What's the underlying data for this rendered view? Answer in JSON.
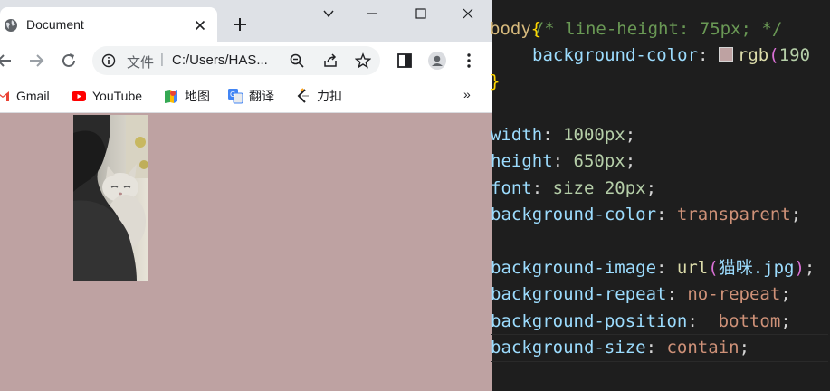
{
  "browser": {
    "tab_title": "Document",
    "address": {
      "scheme_label": "文件",
      "separator": "|",
      "url": "C:/Users/HAS..."
    },
    "bookmarks": [
      {
        "label": "Gmail",
        "icon": "gmail-icon"
      },
      {
        "label": "YouTube",
        "icon": "youtube-icon"
      },
      {
        "label": "地图",
        "icon": "maps-icon"
      },
      {
        "label": "翻译",
        "icon": "translate-icon"
      },
      {
        "label": "力扣",
        "icon": "leetcode-icon"
      }
    ],
    "bookmarks_more": "»",
    "page_background": "#bea2a2"
  },
  "editor": {
    "line1": {
      "text": "/* line-height: 75px; */"
    },
    "line2": {
      "selector": "body",
      "brace": "{"
    },
    "line3": {
      "prop": "background-color",
      "fn": "rgb",
      "args": "190",
      "swatch": "#bea2a2"
    },
    "line4": {
      "brace": "}"
    },
    "line5": {
      "prop": "width",
      "value": "1000px"
    },
    "line6": {
      "prop": "height",
      "value": "650px"
    },
    "line7": {
      "prop": "font",
      "value": "size 20px"
    },
    "line8": {
      "prop": "background-color",
      "value": "transparent"
    },
    "line9": {
      "prop": "background-image",
      "fn": "url",
      "arg": "猫咪.jpg"
    },
    "line10": {
      "prop": "background-repeat",
      "value": "no-repeat"
    },
    "line11": {
      "prop": "background-position",
      "value": "bottom"
    },
    "line12": {
      "prop": "background-size",
      "value": "contain"
    }
  },
  "colors": {
    "editor_bg": "#1e1e1e",
    "comment": "#6a9955",
    "property": "#9cdcfe",
    "string_value": "#ce9178",
    "number": "#b5cea8",
    "function": "#dcdcaa"
  }
}
